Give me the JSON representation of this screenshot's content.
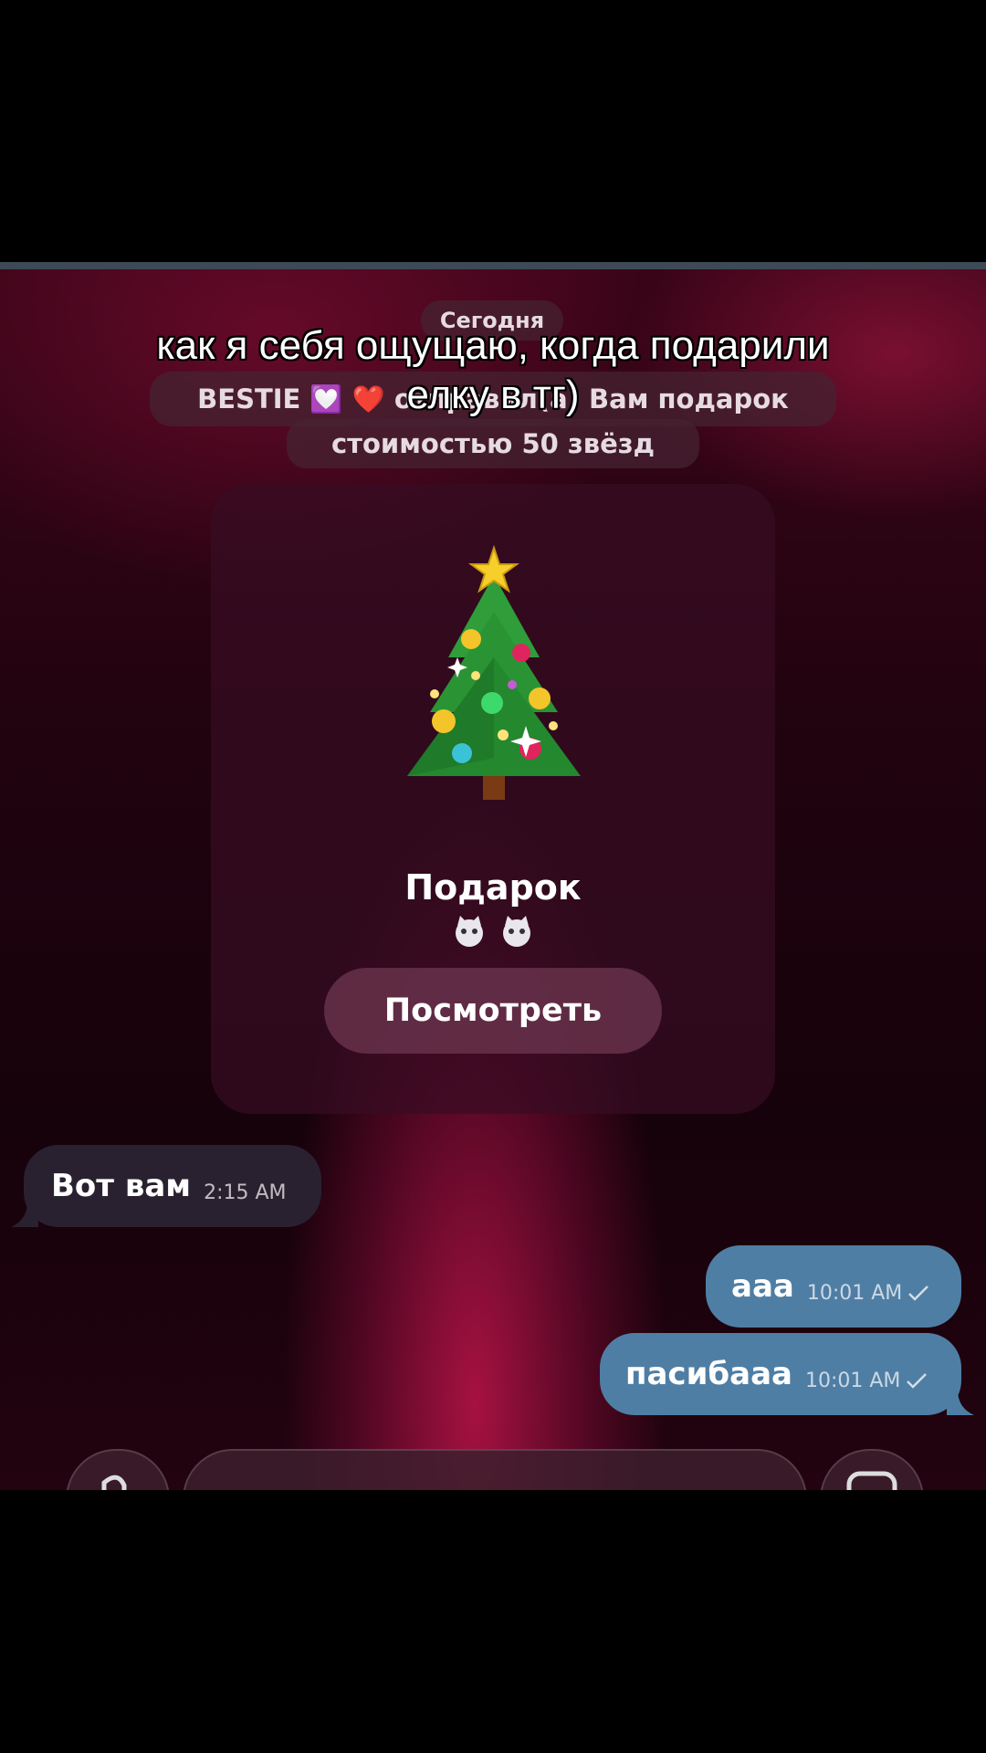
{
  "chat": {
    "date_label": "Сегодня",
    "service_line_1": "BESTIE 💟 ❤️ отправил(а) Вам подарок",
    "service_line_2": "стоимостью 50 звёзд"
  },
  "gift": {
    "title": "Подарок",
    "button_label": "Посмотреть"
  },
  "messages": [
    {
      "text": "Вот вам",
      "time": "2:15 AM",
      "direction": "incoming"
    },
    {
      "text": "ааа",
      "time": "10:01 AM",
      "direction": "outgoing"
    },
    {
      "text": "пасибааа",
      "time": "10:01 AM",
      "direction": "outgoing"
    }
  ],
  "overlay": {
    "caption": "как я себя ощущаю, когда подарили елку в тг)"
  },
  "colors": {
    "incoming_bubble": "#2a2130",
    "outgoing_bubble": "#4f7ea4",
    "gift_card": "#370c23"
  }
}
